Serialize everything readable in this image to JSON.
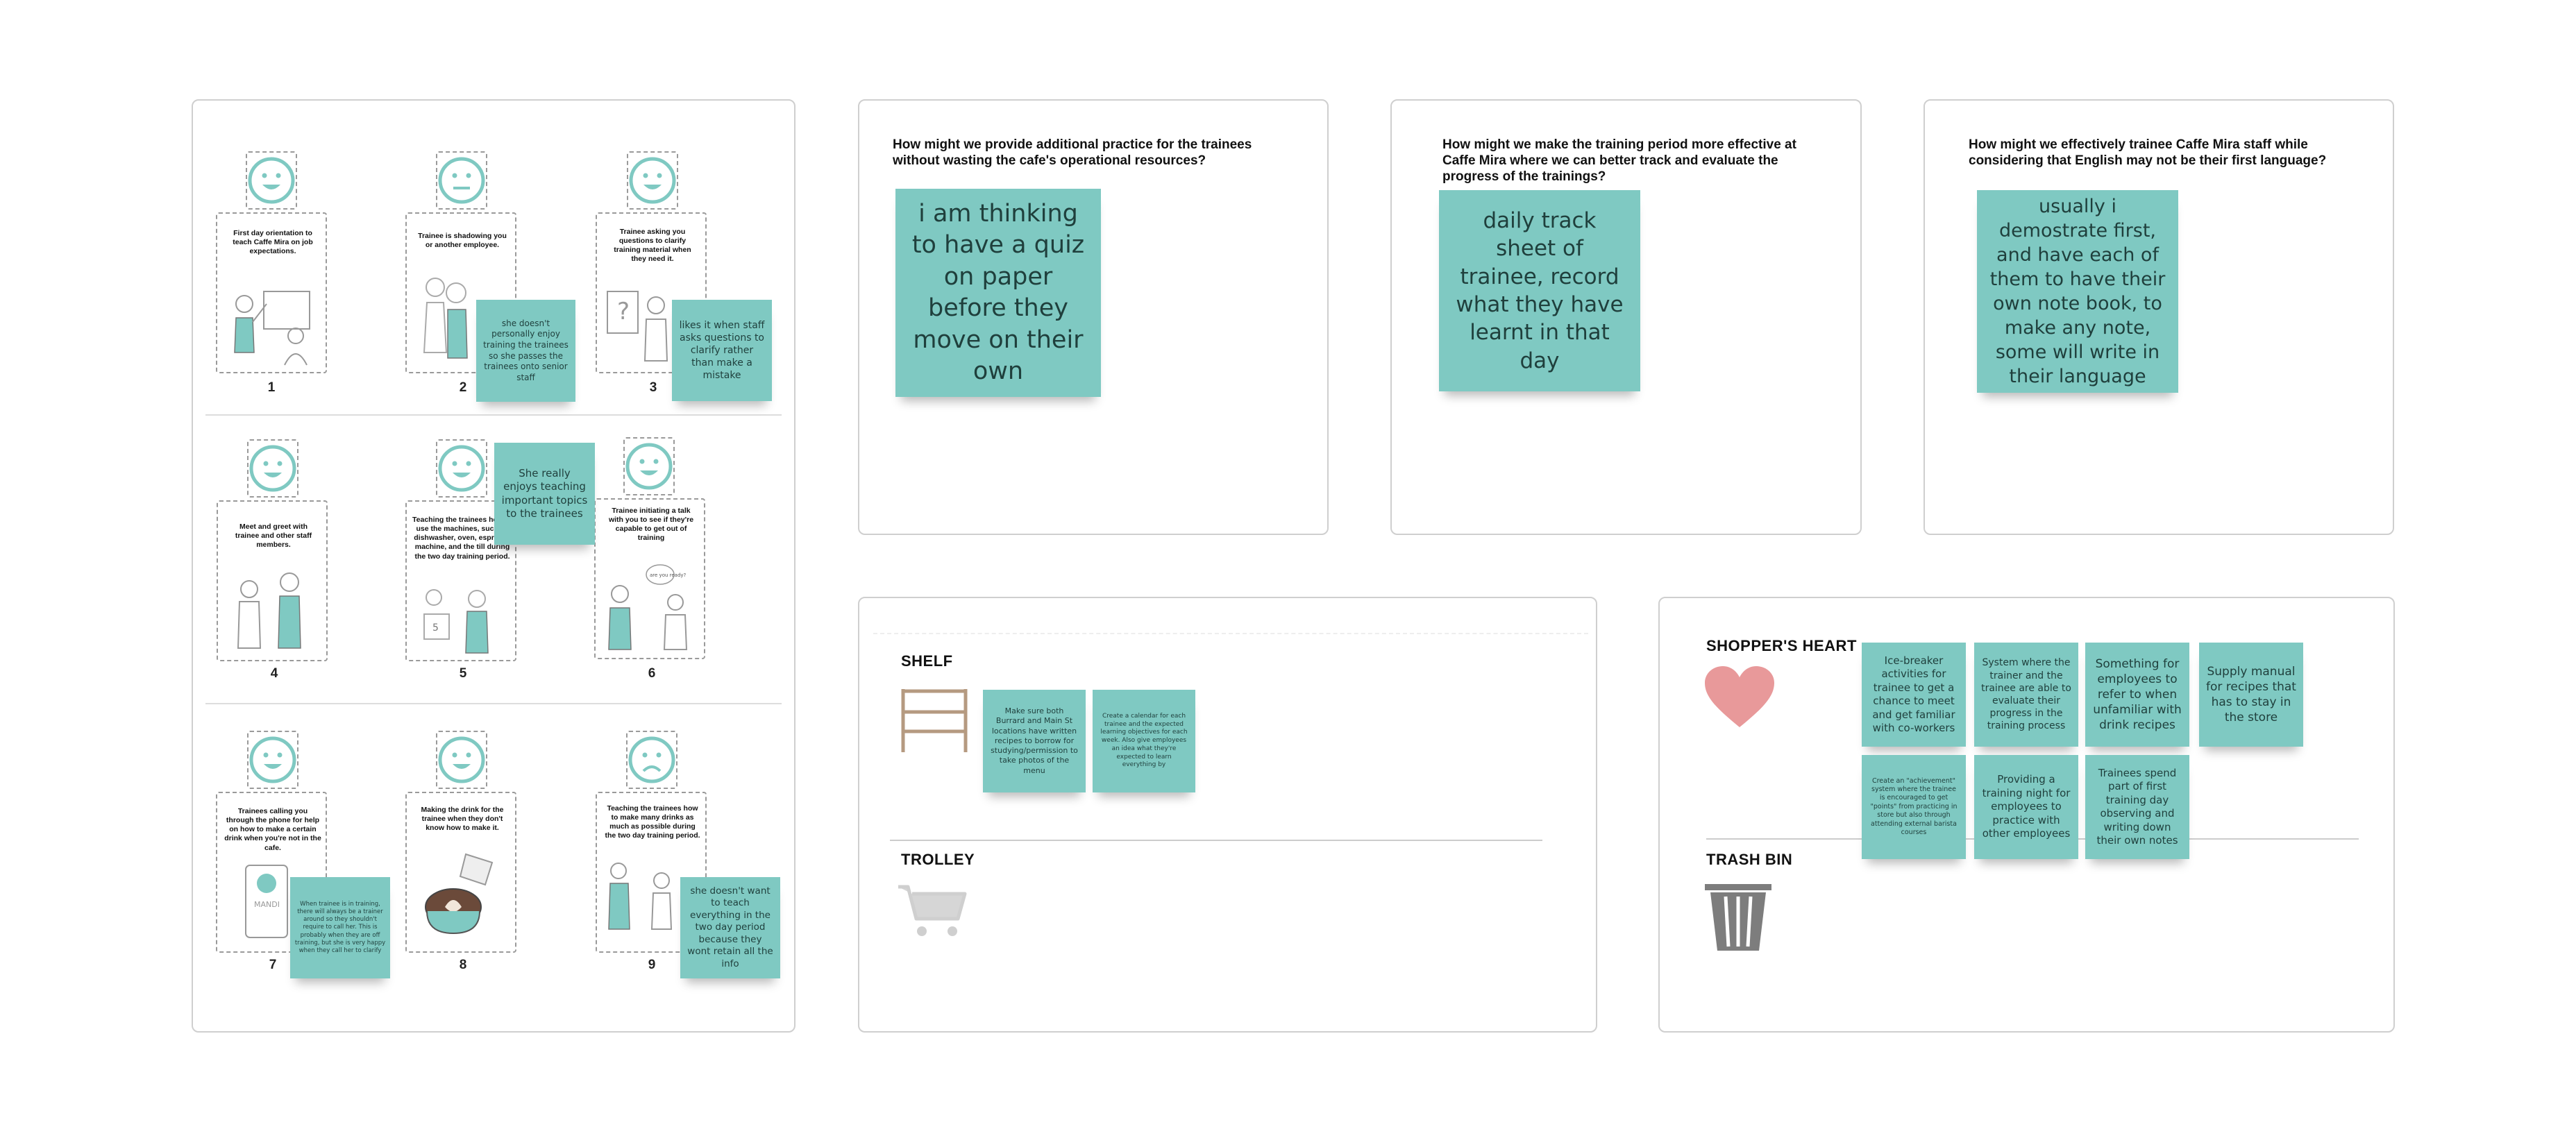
{
  "storyboard": {
    "panels": [
      {
        "caption": "First day orientation to teach Caffe Mira on job expectations.",
        "number": "1",
        "mood": "happy"
      },
      {
        "caption": "Trainee is shadowing you or another employee.",
        "number": "2",
        "mood": "neutral"
      },
      {
        "caption": "Trainee asking you questions to clarify training material when they need it.",
        "number": "3",
        "mood": "happy"
      },
      {
        "caption": "Meet and greet with trainee and other staff members.",
        "number": "4",
        "mood": "happy"
      },
      {
        "caption": "Teaching the trainees how to use the machines, such as dishwasher, oven, espresso machine, and the till during the two day training period.",
        "number": "5",
        "mood": "happy"
      },
      {
        "caption": "Trainee initiating a talk with you to see if they're capable to get out of training",
        "number": "6",
        "mood": "happy"
      },
      {
        "caption": "Trainees calling you through the phone for help on how to make a certain drink when you're not in the cafe.",
        "number": "7",
        "mood": "happy"
      },
      {
        "caption": "Making the drink for the trainee when they don't know how to make it.",
        "number": "8",
        "mood": "happy"
      },
      {
        "caption": "Teaching the trainees how to make many drinks as much as possible during the two day training period.",
        "number": "9",
        "mood": "sad"
      }
    ],
    "notes": [
      "she doesn't personally enjoy training the trainees so she passes the trainees onto senior staff",
      "likes it when staff asks questions to clarify rather than make a mistake",
      "She really enjoys teaching important topics to the trainees",
      "When trainee is in training, there will always be a trainer around so they shouldn't require to call her. This is probably when they are off training, but she is very happy when they call her to clarify",
      "she doesn't want to teach everything in the two day period because they wont retain all the info"
    ],
    "illustration_texts": {
      "phone": "MANDI",
      "speech": "are you ready?"
    }
  },
  "hmw": [
    {
      "question": "How might we provide additional practice for the trainees without wasting the cafe's operational resources?",
      "answer": "i am thinking to have a quiz on paper before they move on their own"
    },
    {
      "question": "How might we make the training period more effective at Caffe Mira where we can better track and evaluate the progress of the trainings?",
      "answer": "daily track sheet of trainee, record what they have learnt in that day"
    },
    {
      "question": "How might we effectively trainee Caffe Mira staff while considering that English may not be their first language?",
      "answer": "usually i demostrate first, and have each of them to have their own note book, to make any note, some will write in their language"
    }
  ],
  "shelf_board": {
    "shelf_label": "SHELF",
    "trolley_label": "TROLLEY",
    "shelf_notes": [
      "Make sure both Burrard and Main St locations have written recipes to borrow for studying/permission to take photos of the menu",
      "Create a calendar for each trainee and the expected learning objectives for each week. Also give employees an idea what they're expected to learn everything by"
    ]
  },
  "heart_board": {
    "heart_label": "SHOPPER'S HEART",
    "trash_label": "TRASH BIN",
    "notes": [
      "Ice-breaker activities for trainee to get a chance to meet and get familiar with co-workers",
      "System where the trainer and the trainee are able to evaluate their progress in the training process",
      "Something for employees to refer to when unfamiliar with drink recipes",
      "Supply manual for recipes that has to stay in the store",
      "Create an \"achievement\" system where the trainee is encouraged to get \"points\" from practicing in store but also through attending external barista courses",
      "Providing a training night for employees to practice with other employees",
      "Trainees spend part of first training day observing and writing down their own notes"
    ]
  },
  "colors": {
    "sticky": "#7fc9c2",
    "heart": "#e8999a",
    "shelf": "#b59a80",
    "trash": "#7d7d7d",
    "trolley": "#cfcfcf"
  }
}
